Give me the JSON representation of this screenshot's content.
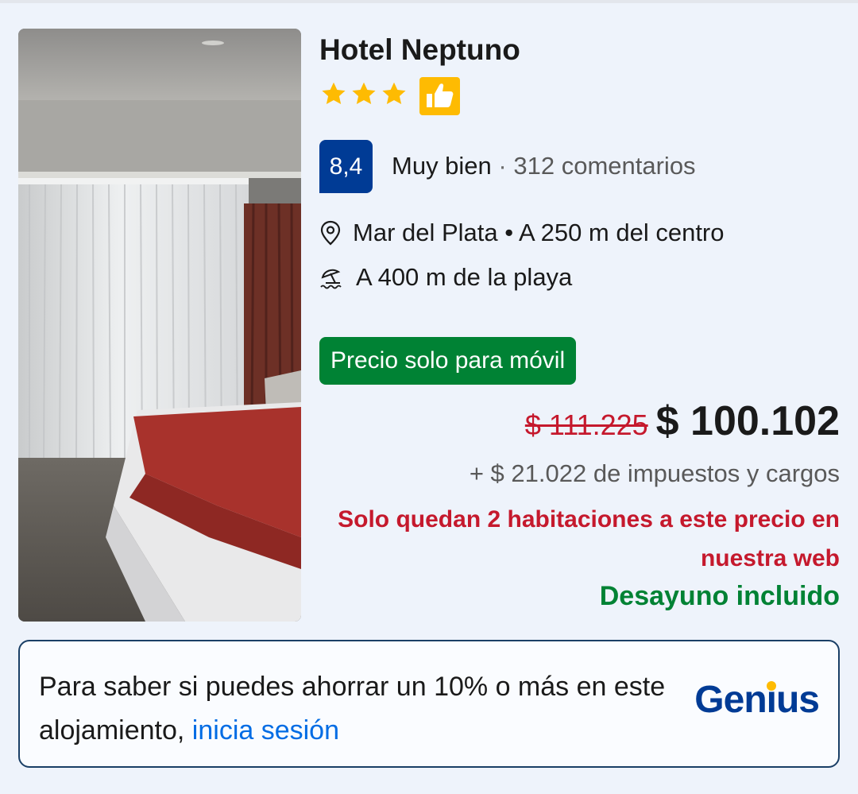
{
  "hotel": {
    "name": "Hotel Neptuno",
    "stars": 3,
    "score": "8,4",
    "score_label": "Muy bien",
    "score_separator": "·",
    "reviews": "312 comentarios",
    "location": "Mar del Plata • A 250 m del centro",
    "beach": "A 400 m de la playa"
  },
  "offer": {
    "mobile_badge": "Precio solo para móvil",
    "old_price": "$ 111.225",
    "new_price": "$ 100.102",
    "taxes": "+ $ 21.022 de impuestos y cargos",
    "rooms_left": "Solo quedan 2 habitaciones a este precio en nuestra web",
    "breakfast": "Desayuno incluido"
  },
  "genius": {
    "text": "Para saber si puedes ahorrar un 10% o más en este alojamiento,",
    "link": "inicia sesión",
    "logo_pre": "Gen",
    "logo_i": "i",
    "logo_post": "us"
  },
  "icons": [
    "star-icon",
    "thumbs-up-icon",
    "map-pin-icon",
    "beach-icon"
  ],
  "colors": {
    "background": "#eef3fb",
    "brand_blue": "#003b95",
    "link_blue": "#006ce4",
    "green": "#008234",
    "red": "#c5192d",
    "star_yellow": "#febb02"
  }
}
